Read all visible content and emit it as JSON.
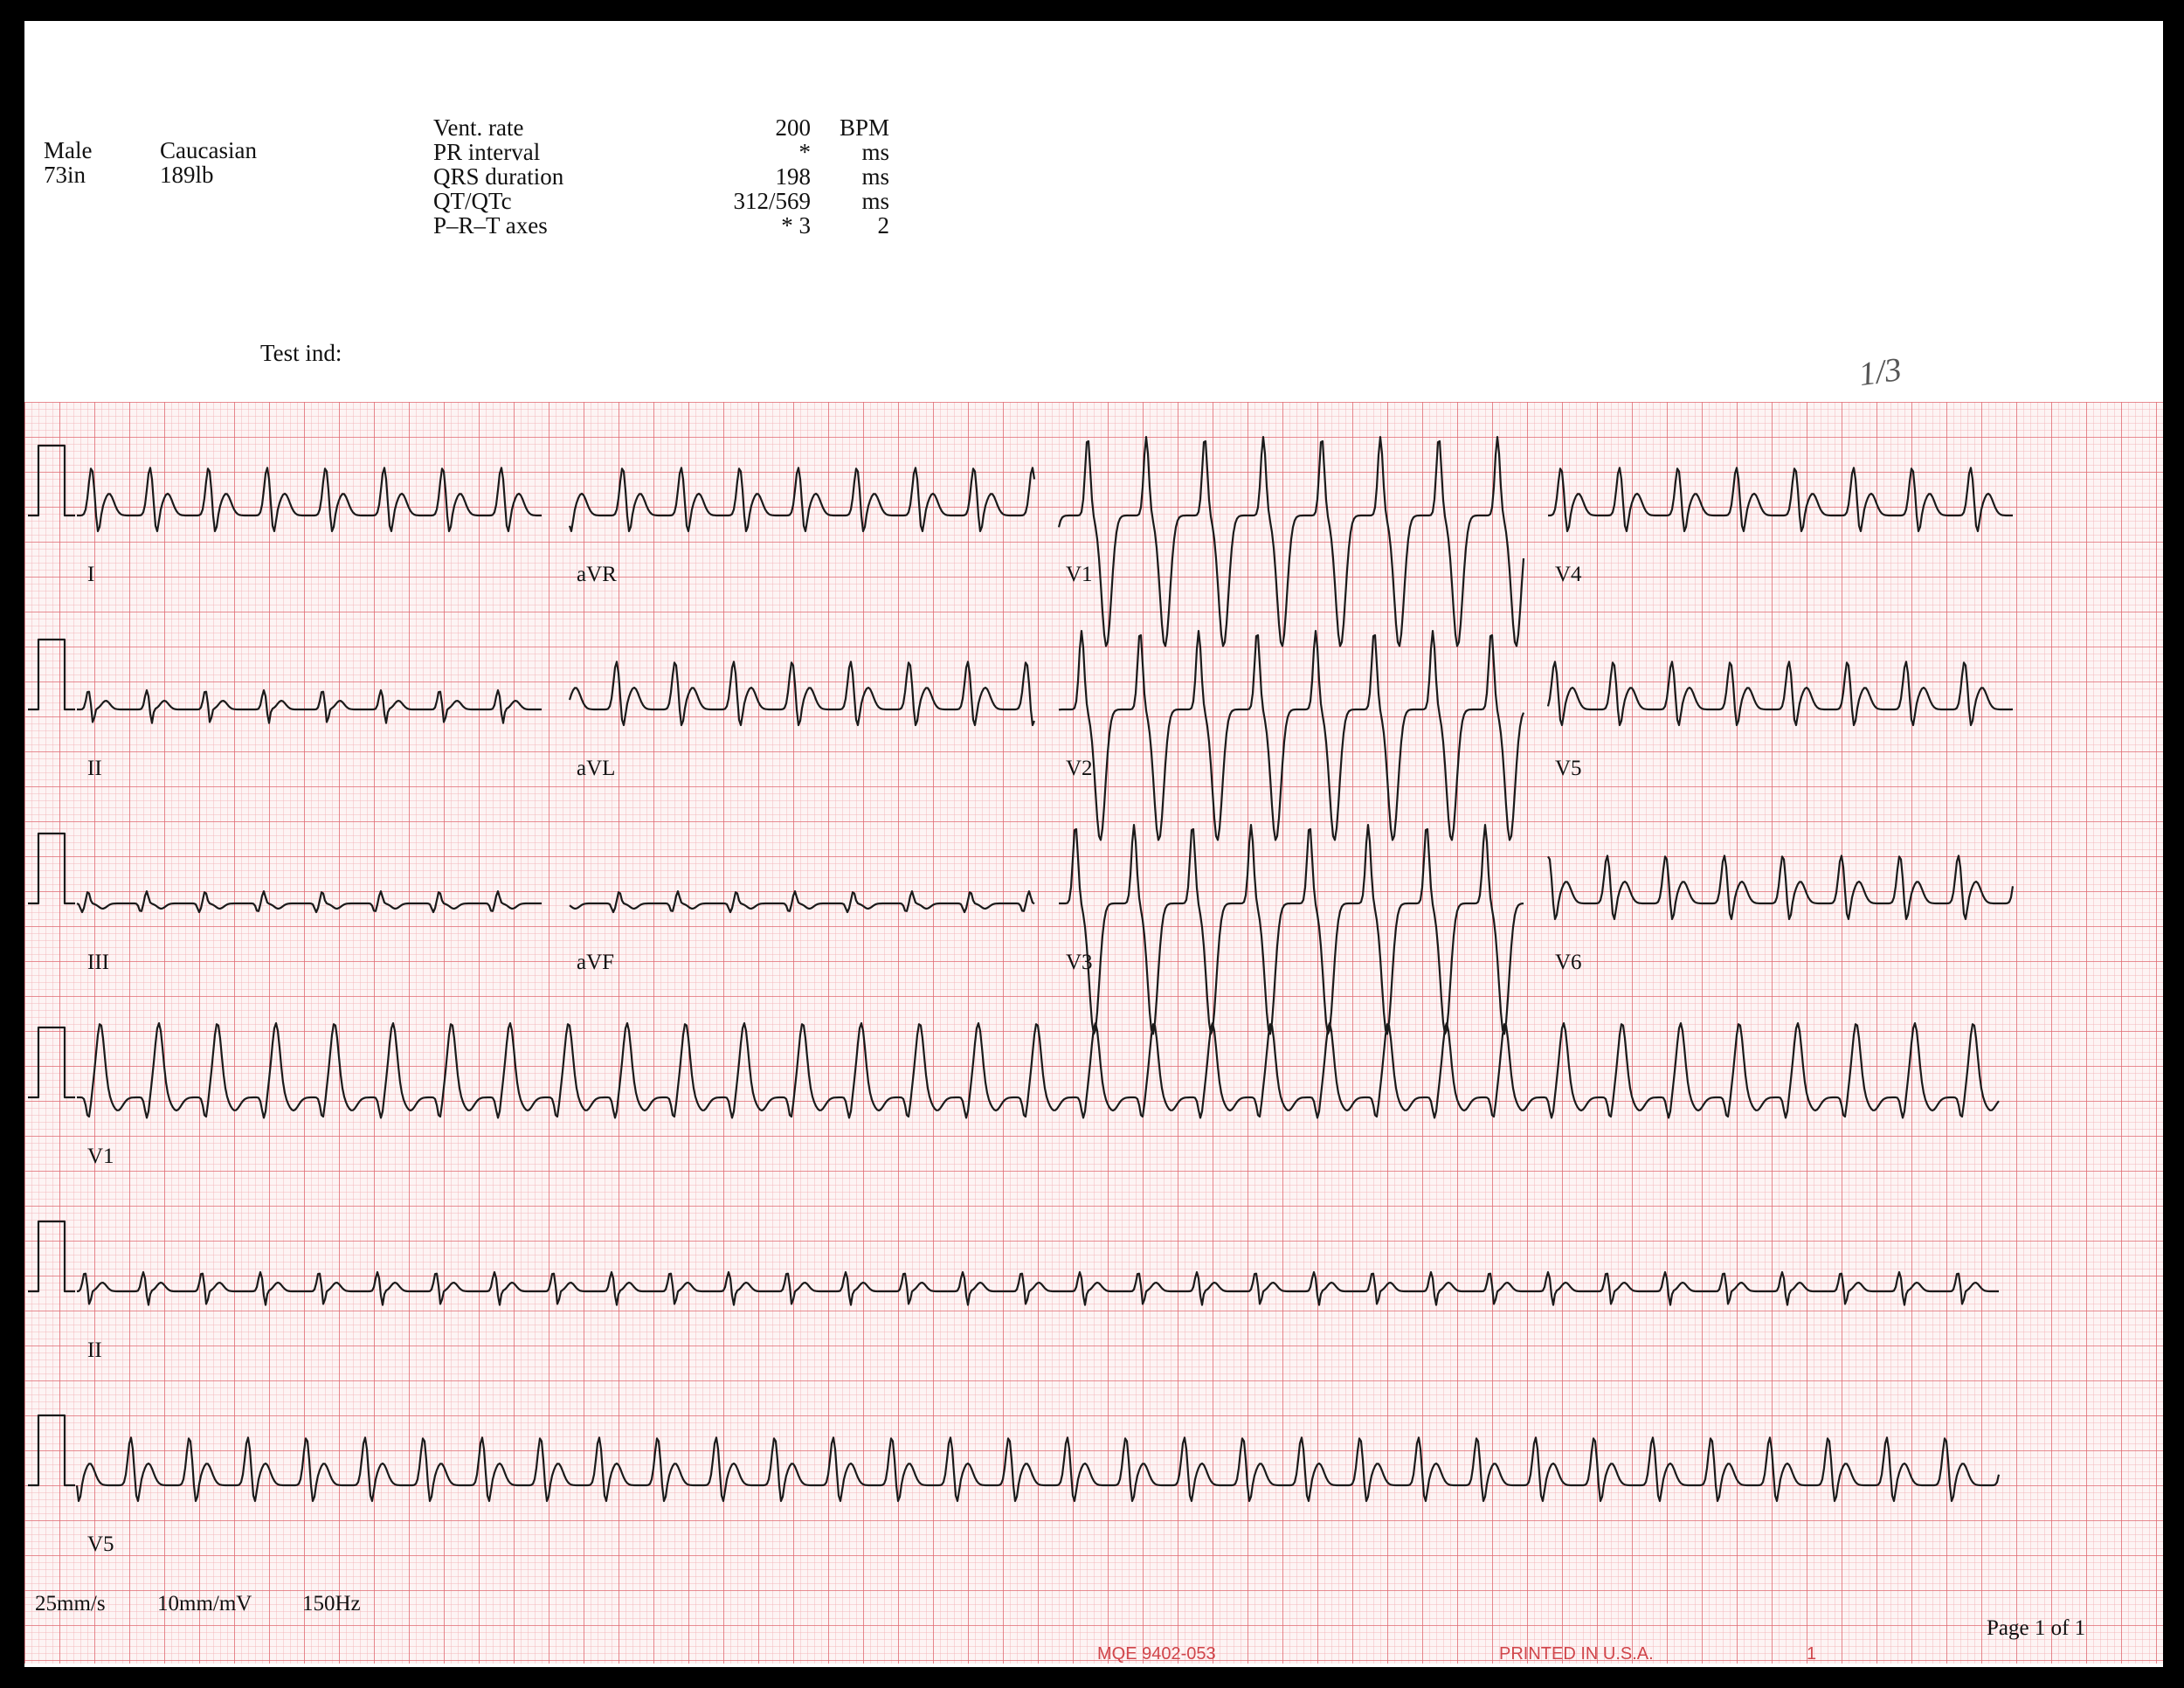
{
  "patient": {
    "sex": "Male",
    "race": "Caucasian",
    "height": "73in",
    "weight": "189lb"
  },
  "measurements": [
    {
      "label": "Vent. rate",
      "value": "200",
      "unit": "BPM"
    },
    {
      "label": "PR interval",
      "value": "*",
      "unit": "ms"
    },
    {
      "label": "QRS duration",
      "value": "198",
      "unit": "ms"
    },
    {
      "label": "QT/QTc",
      "value": "312/569",
      "unit": "ms"
    },
    {
      "label": "P–R–T axes",
      "value": "*  3",
      "unit": "2"
    }
  ],
  "test_ind_label": "Test ind:",
  "handwritten_note": "1/3",
  "leads": {
    "row1": [
      "I",
      "aVR",
      "V1",
      "V4"
    ],
    "row2": [
      "II",
      "aVL",
      "V2",
      "V5"
    ],
    "row3": [
      "III",
      "aVF",
      "V3",
      "V6"
    ],
    "rhythm": [
      "V1",
      "II",
      "V5"
    ]
  },
  "settings": {
    "speed": "25mm/s",
    "gain": "10mm/mV",
    "filter": "150Hz"
  },
  "page_label": "Page 1 of 1",
  "footer": {
    "form_code": "MQE  9402-053",
    "printed": "PRINTED IN U.S.A.",
    "page_num": "1"
  },
  "colors": {
    "grid_minor": "#f3b7bb",
    "grid_major": "#e06a72",
    "trace": "#1a1a1a",
    "footer": "#d0454a"
  }
}
